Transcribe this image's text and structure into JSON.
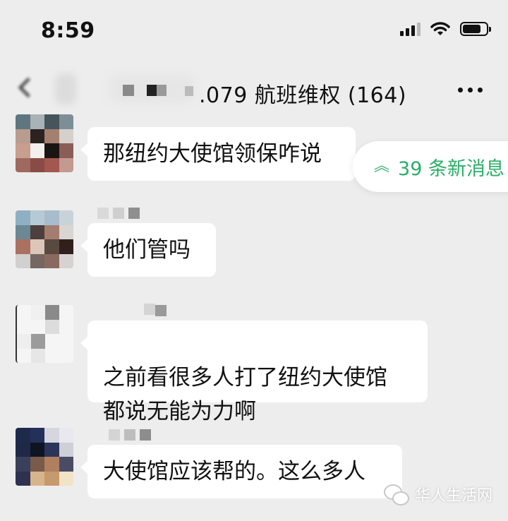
{
  "status_bar": {
    "time": "8:59",
    "icons": [
      "signal-icon",
      "wifi-icon",
      "battery-icon"
    ]
  },
  "nav_bar": {
    "title": ".079 航班维权 (164)",
    "back_icon": "back-icon",
    "more_icon": "more-icon"
  },
  "messages": [
    {
      "text": "那纽约大使馆领保咋说"
    },
    {
      "text": "他们管吗"
    },
    {
      "text": "之前看很多人打了纽约大使馆\n都说无能为力啊"
    },
    {
      "text": "大使馆应该帮的。这么多人"
    }
  ],
  "new_messages": {
    "label": "39 条新消息",
    "icon": "double-chevron-up-icon",
    "color": "#2aae67"
  },
  "watermark": {
    "text": "华人生活网",
    "icon": "wechat-logo-icon"
  },
  "colors": {
    "background": "#ededed",
    "bubble": "#ffffff",
    "accent": "#2aae67"
  }
}
